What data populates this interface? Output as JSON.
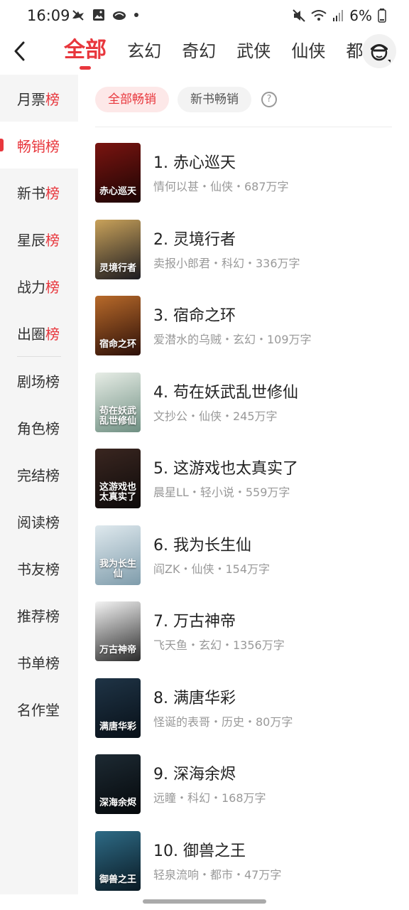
{
  "status_bar": {
    "time": "16:09",
    "battery": "6%"
  },
  "header": {
    "tabs": [
      {
        "label": "全部",
        "active": true
      },
      {
        "label": "玄幻",
        "active": false
      },
      {
        "label": "奇幻",
        "active": false
      },
      {
        "label": "武侠",
        "active": false
      },
      {
        "label": "仙侠",
        "active": false
      },
      {
        "label": "都",
        "active": false
      }
    ]
  },
  "sidebar": {
    "items": [
      {
        "prefix": "月票",
        "suffix": "榜",
        "active": false
      },
      {
        "prefix": "畅销",
        "suffix": "榜",
        "active": true
      },
      {
        "prefix": "新书",
        "suffix": "榜",
        "active": false
      },
      {
        "prefix": "星辰",
        "suffix": "榜",
        "active": false
      },
      {
        "prefix": "战力",
        "suffix": "榜",
        "active": false
      },
      {
        "prefix": "出圈",
        "suffix": "榜",
        "active": false
      },
      {
        "prefix": "剧场榜",
        "suffix": "",
        "active": false
      },
      {
        "prefix": "角色榜",
        "suffix": "",
        "active": false
      },
      {
        "prefix": "完结榜",
        "suffix": "",
        "active": false
      },
      {
        "prefix": "阅读榜",
        "suffix": "",
        "active": false
      },
      {
        "prefix": "书友榜",
        "suffix": "",
        "active": false
      },
      {
        "prefix": "推荐榜",
        "suffix": "",
        "active": false
      },
      {
        "prefix": "书单榜",
        "suffix": "",
        "active": false
      },
      {
        "prefix": "名作堂",
        "suffix": "",
        "active": false
      }
    ]
  },
  "filters": {
    "all_label": "全部畅销",
    "new_label": "新书畅销",
    "help_symbol": "?"
  },
  "books": [
    {
      "title": "1. 赤心巡天",
      "meta": "情何以甚・仙侠・687万字",
      "cover_text": "赤心巡天",
      "cover_colors": [
        "#7a1410",
        "#1c0504"
      ]
    },
    {
      "title": "2. 灵境行者",
      "meta": "卖报小郎君・科幻・336万字",
      "cover_text": "灵境行者",
      "cover_colors": [
        "#c9a25a",
        "#1b1a20"
      ]
    },
    {
      "title": "3. 宿命之环",
      "meta": "爱潜水的乌贼・玄幻・109万字",
      "cover_text": "宿命之环",
      "cover_colors": [
        "#b86a2a",
        "#2c0f08"
      ]
    },
    {
      "title": "4. 苟在妖武乱世修仙",
      "meta": "文抄公・仙侠・245万字",
      "cover_text": "苟在妖武乱世修仙",
      "cover_colors": [
        "#e7ede6",
        "#6f8f82"
      ]
    },
    {
      "title": "5. 这游戏也太真实了",
      "meta": "晨星LL・轻小说・559万字",
      "cover_text": "这游戏也太真实了",
      "cover_colors": [
        "#3a2620",
        "#0d0a0a"
      ]
    },
    {
      "title": "6. 我为长生仙",
      "meta": "阎ZK・仙侠・154万字",
      "cover_text": "我为长生仙",
      "cover_colors": [
        "#dfe9ee",
        "#7f9cab"
      ]
    },
    {
      "title": "7. 万古神帝",
      "meta": "飞天鱼・玄幻・1356万字",
      "cover_text": "万古神帝",
      "cover_colors": [
        "#f4f4f4",
        "#2a2a2a"
      ]
    },
    {
      "title": "8. 满唐华彩",
      "meta": "怪诞的表哥・历史・80万字",
      "cover_text": "满唐华彩",
      "cover_colors": [
        "#1f3446",
        "#081018"
      ]
    },
    {
      "title": "9. 深海余烬",
      "meta": "远瞳・科幻・168万字",
      "cover_text": "深海余烬",
      "cover_colors": [
        "#1d2a33",
        "#05080b"
      ]
    },
    {
      "title": "10. 御兽之王",
      "meta": "轻泉流响・都市・47万字",
      "cover_text": "御兽之王",
      "cover_colors": [
        "#2e6b86",
        "#0a1a24"
      ]
    }
  ]
}
